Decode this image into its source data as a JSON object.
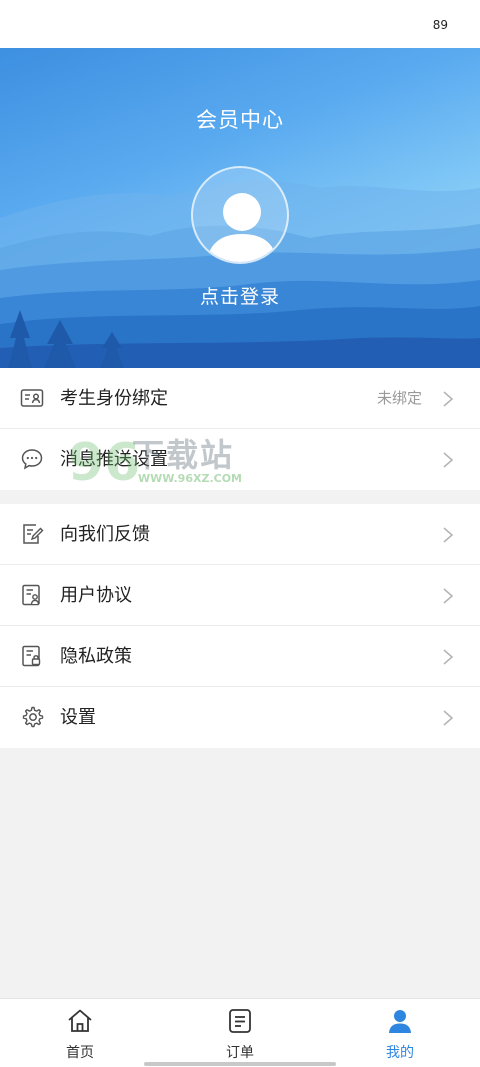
{
  "status_bar": {
    "battery": "89"
  },
  "header": {
    "title": "会员中心",
    "login_label": "点击登录"
  },
  "menu_group_1": [
    {
      "label": "考生身份绑定",
      "value": "未绑定",
      "icon": "id-card-icon"
    },
    {
      "label": "消息推送设置",
      "value": "",
      "icon": "chat-bubble-icon"
    }
  ],
  "menu_group_2": [
    {
      "label": "向我们反馈",
      "icon": "feedback-edit-icon"
    },
    {
      "label": "用户协议",
      "icon": "agreement-doc-icon"
    },
    {
      "label": "隐私政策",
      "icon": "privacy-doc-icon"
    },
    {
      "label": "设置",
      "icon": "gear-icon"
    }
  ],
  "watermark": {
    "title": "下载站",
    "url": "WWW.96XZ.COM"
  },
  "tabbar": {
    "items": [
      {
        "label": "首页",
        "icon": "home-icon",
        "active": false
      },
      {
        "label": "订单",
        "icon": "order-list-icon",
        "active": false
      },
      {
        "label": "我的",
        "icon": "person-icon",
        "active": true
      }
    ]
  },
  "colors": {
    "accent": "#2f86e0",
    "hero_dark": "#2a6fcb",
    "hero_light": "#b8ecff",
    "background": "#f2f2f2"
  }
}
